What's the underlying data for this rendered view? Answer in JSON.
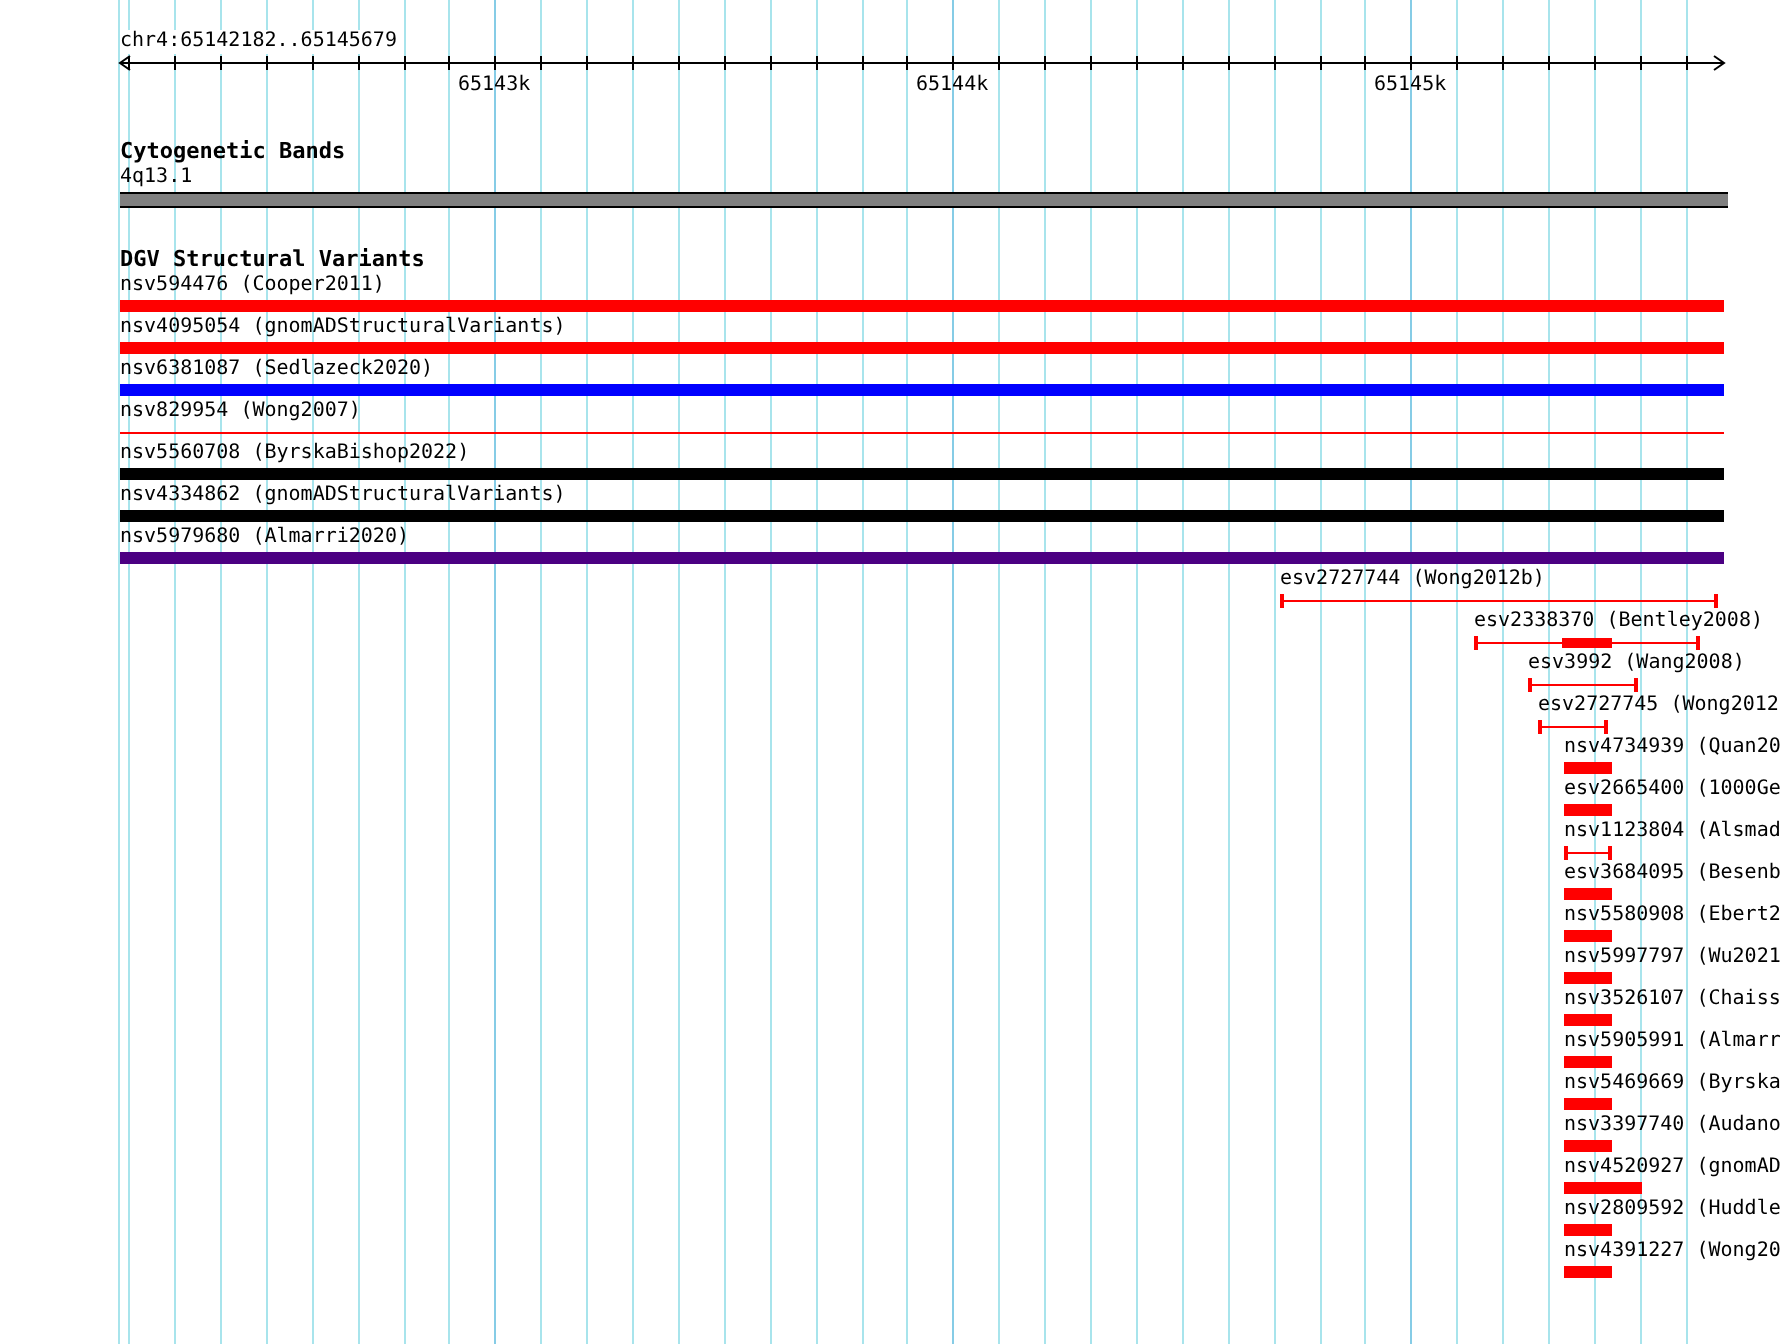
{
  "locus": "chr4:65142182..65145679",
  "ruler": {
    "ticks": [
      {
        "label": "65143k"
      },
      {
        "label": "65144k"
      },
      {
        "label": "65145k"
      }
    ]
  },
  "tracks": [
    {
      "title": "Cytogenetic Bands",
      "features": [
        {
          "label": "4q13.1",
          "kind": "band",
          "color": "#808080"
        }
      ]
    },
    {
      "title": "DGV Structural Variants",
      "features": [
        {
          "label": "nsv594476 (Cooper2011)",
          "kind": "bar",
          "color": "#ff0000"
        },
        {
          "label": "nsv4095054 (gnomADStructuralVariants)",
          "kind": "bar",
          "color": "#ff0000"
        },
        {
          "label": "nsv6381087 (Sedlazeck2020)",
          "kind": "bar",
          "color": "#0000ff"
        },
        {
          "label": "nsv829954 (Wong2007)",
          "kind": "line",
          "color": "#ff0000"
        },
        {
          "label": "nsv5560708 (ByrskaBishop2022)",
          "kind": "bar",
          "color": "#000000"
        },
        {
          "label": "nsv4334862 (gnomADStructuralVariants)",
          "kind": "bar",
          "color": "#000000"
        },
        {
          "label": "nsv5979680 (Almarri2020)",
          "kind": "bar",
          "color": "#4b0082"
        },
        {
          "label": "esv2727744 (Wong2012b)",
          "kind": "whisker",
          "color": "#ff0000"
        },
        {
          "label": "esv2338370 (Bentley2008)",
          "kind": "whisker-block",
          "color": "#ff0000"
        },
        {
          "label": "esv3992 (Wang2008)",
          "kind": "whisker",
          "color": "#ff0000"
        },
        {
          "label": "esv2727745 (Wong2012",
          "kind": "whisker",
          "color": "#ff0000"
        },
        {
          "label": "nsv4734939 (Quan20",
          "kind": "bar",
          "color": "#ff0000"
        },
        {
          "label": "esv2665400 (1000Ge",
          "kind": "bar",
          "color": "#ff0000"
        },
        {
          "label": "nsv1123804 (Alsmad",
          "kind": "whisker",
          "color": "#ff0000"
        },
        {
          "label": "esv3684095 (Besenb",
          "kind": "bar",
          "color": "#ff0000"
        },
        {
          "label": "nsv5580908 (Ebert2",
          "kind": "bar",
          "color": "#ff0000"
        },
        {
          "label": "nsv5997797 (Wu2021",
          "kind": "bar",
          "color": "#ff0000"
        },
        {
          "label": "nsv3526107 (Chaiss",
          "kind": "bar",
          "color": "#ff0000"
        },
        {
          "label": "nsv5905991 (Almarr",
          "kind": "bar",
          "color": "#ff0000"
        },
        {
          "label": "nsv5469669 (Byrska",
          "kind": "bar",
          "color": "#ff0000"
        },
        {
          "label": "nsv3397740 (Audano",
          "kind": "bar",
          "color": "#ff0000"
        },
        {
          "label": "nsv4520927 (gnomAD",
          "kind": "bar",
          "color": "#ff0000"
        },
        {
          "label": "nsv2809592 (Huddle",
          "kind": "bar",
          "color": "#ff0000"
        },
        {
          "label": "nsv4391227 (Wong20",
          "kind": "bar",
          "color": "#ff0000"
        }
      ]
    }
  ]
}
